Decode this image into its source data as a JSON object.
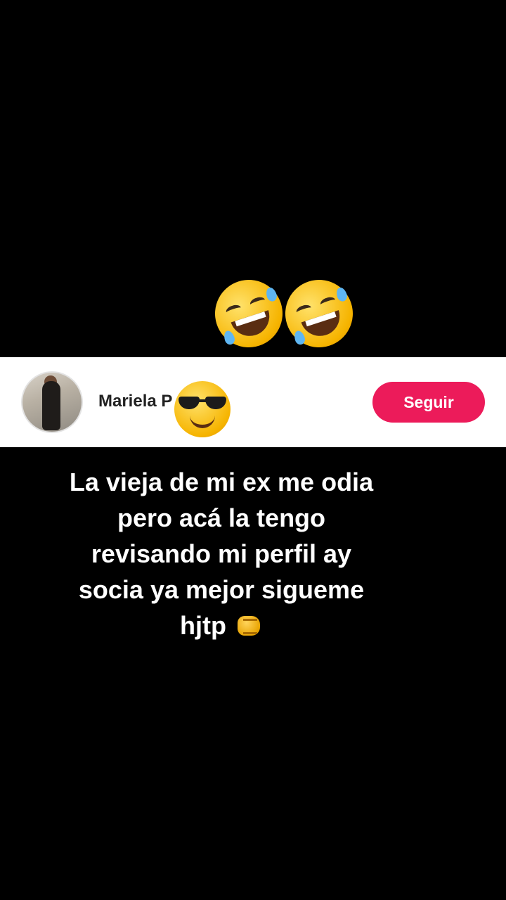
{
  "reaction": {
    "emojis": [
      "rolling-on-floor-laughing-icon",
      "rolling-on-floor-laughing-icon"
    ]
  },
  "profile": {
    "username": "Mariela P      05",
    "overlay_emoji": "smiling-face-with-sunglasses-icon",
    "follow_label": "Seguir",
    "follow_color": "#ec1b5a"
  },
  "caption": {
    "lines": [
      "La vieja de mi ex me odia",
      "pero acá la tengo",
      "revisando mi perfil ay",
      "socia ya mejor sigueme",
      "hjtp"
    ],
    "end_emoji": "oncoming-fist-icon"
  },
  "colors": {
    "background": "#000000",
    "profile_bar": "#ffffff"
  }
}
